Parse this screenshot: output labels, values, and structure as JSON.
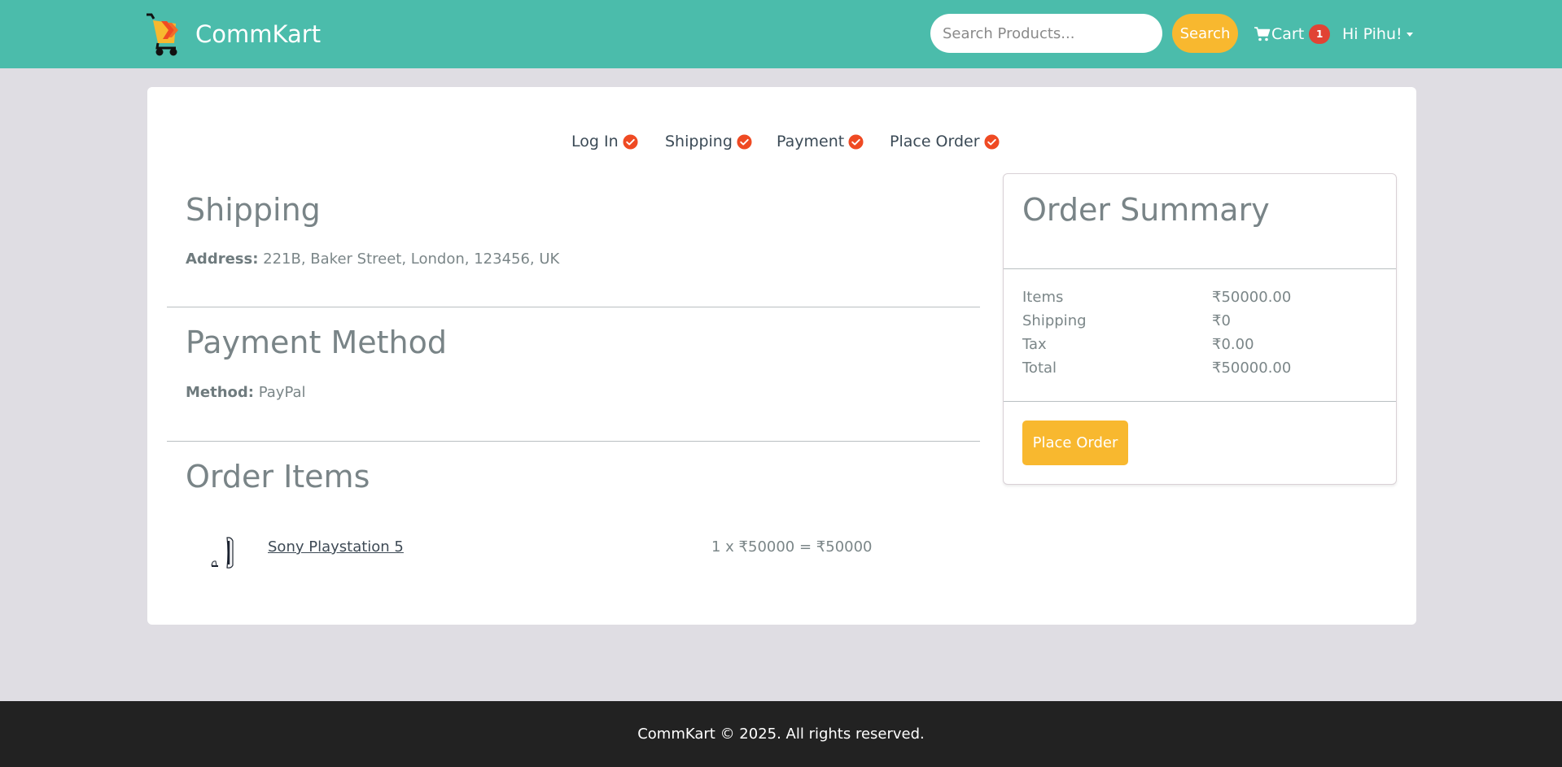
{
  "header": {
    "brand_name": "CommKart",
    "search": {
      "placeholder": "Search Products...",
      "value": "",
      "button_label": "Search"
    },
    "cart": {
      "label": "Cart",
      "count": "1"
    },
    "user": {
      "greeting": "Hi Pihu!"
    }
  },
  "checkout_steps": [
    {
      "label": "Log In",
      "completed": true
    },
    {
      "label": "Shipping",
      "completed": true
    },
    {
      "label": "Payment",
      "completed": true
    },
    {
      "label": "Place Order",
      "completed": true
    }
  ],
  "shipping": {
    "title": "Shipping",
    "address_label": "Address:",
    "address_value": " 221B, Baker Street, London, 123456, UK"
  },
  "payment": {
    "title": "Payment Method",
    "method_label": "Method:",
    "method_value": " PayPal"
  },
  "order_items": {
    "title": "Order Items",
    "items": [
      {
        "name": "Sony Playstation 5",
        "price_line": "1 x ₹50000 = ₹50000"
      }
    ]
  },
  "summary": {
    "title": "Order Summary",
    "rows": [
      {
        "label": "Items",
        "value": "₹50000.00"
      },
      {
        "label": "Shipping",
        "value": "₹0"
      },
      {
        "label": "Tax",
        "value": "₹0.00"
      },
      {
        "label": "Total",
        "value": "₹50000.00"
      }
    ],
    "button_label": "Place Order"
  },
  "footer": {
    "text": "CommKart © 2025. All rights reserved."
  },
  "colors": {
    "navbar": "#4bbcab",
    "accent": "#f8b82f",
    "check": "#ef4a23",
    "badge": "#e14334",
    "footer": "#222222",
    "page_bg": "#dfdde3"
  }
}
